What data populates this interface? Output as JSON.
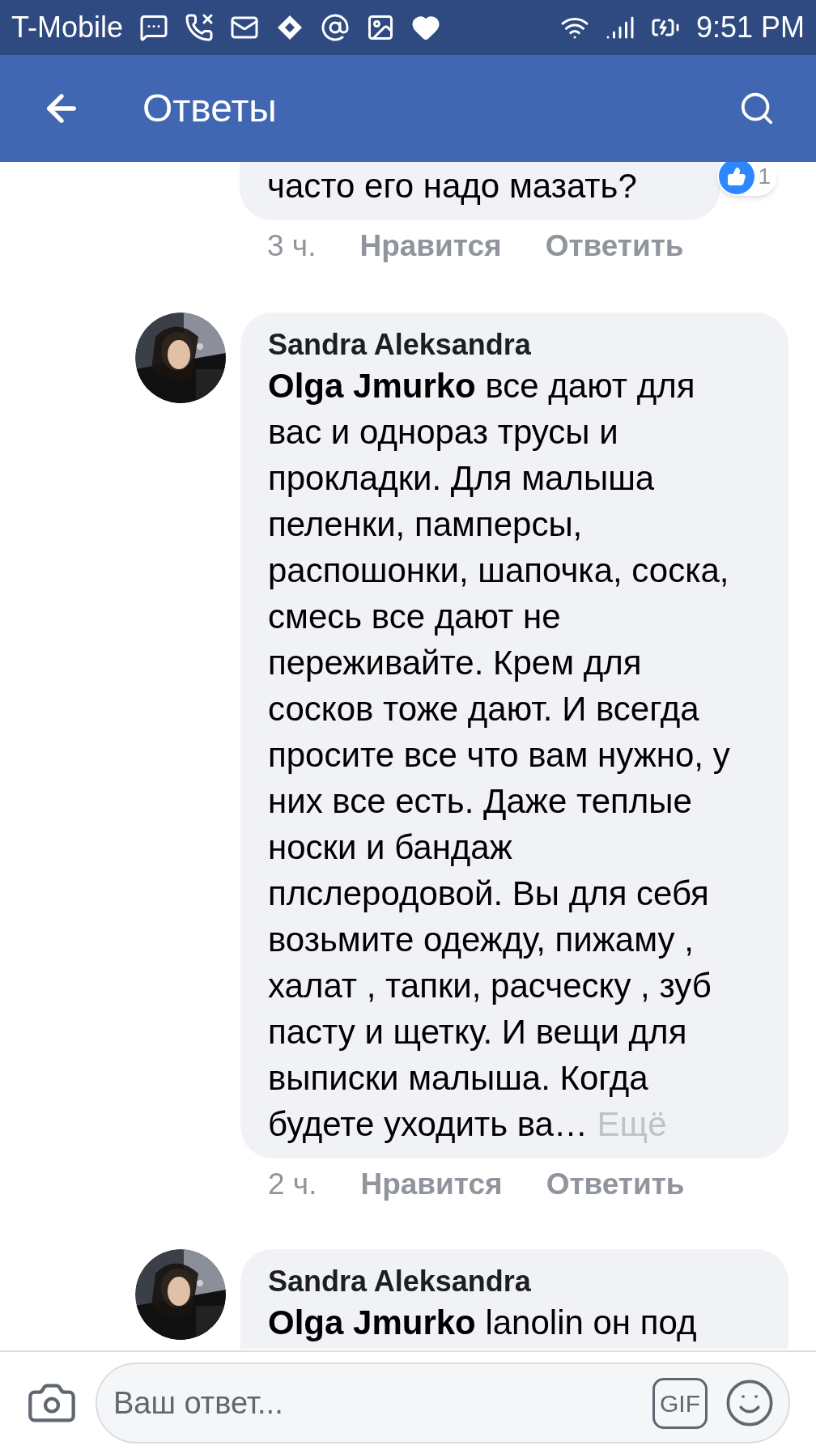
{
  "status_bar": {
    "carrier": "T-Mobile",
    "time": "9:51 PM"
  },
  "header": {
    "title": "Ответы"
  },
  "comments": [
    {
      "body": "часто его надо мазать?",
      "reaction_count": "1",
      "time": "3 ч.",
      "like": "Нравится",
      "reply": "Ответить"
    },
    {
      "author": "Sandra Aleksandra",
      "body": "**Olga Jmurko** все дают для вас и однораз трусы и прокладки. Для малыша пеленки, памперсы, распошонки, шапочка, соска, смесь все дают не переживайте. Крем для сосков тоже дают. И всегда просите все что вам нужно, у них все есть. Даже теплые носки и бандаж плслеродовой. Вы для себя возьмите одежду, пижаму , халат , тапки, расческу , зуб пасту и щетку. И вещи для выписки малыша. Когда будете уходить ва…",
      "more": "Ещё",
      "time": "2 ч.",
      "like": "Нравится",
      "reply": "Ответить"
    },
    {
      "author": "Sandra Aleksandra",
      "body": "**Olga Jmurko** lanolin он под"
    }
  ],
  "composer": {
    "placeholder": "Ваш ответ...",
    "gif_label": "GIF"
  }
}
